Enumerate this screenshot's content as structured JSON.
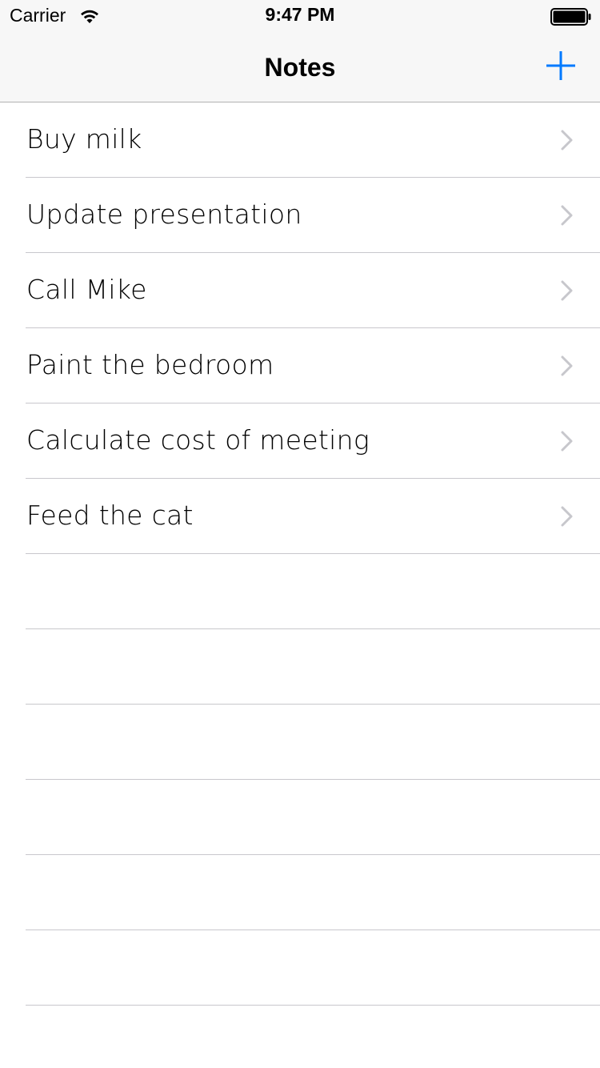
{
  "status_bar": {
    "carrier": "Carrier",
    "time": "9:47 PM",
    "wifi_icon": "wifi-icon",
    "battery_icon": "battery-icon"
  },
  "nav_bar": {
    "title": "Notes",
    "add_icon": "plus-icon",
    "accent_color": "#007aff"
  },
  "notes": {
    "items": [
      {
        "label": "Buy milk"
      },
      {
        "label": "Update presentation"
      },
      {
        "label": "Call Mike"
      },
      {
        "label": "Paint the bedroom"
      },
      {
        "label": "Calculate cost of meeting"
      },
      {
        "label": "Feed the cat"
      }
    ],
    "chevron_icon": "chevron-right-icon",
    "empty_rows": 6
  },
  "colors": {
    "nav_background": "#f7f7f7",
    "separator": "#c8c7cc",
    "chevron": "#c7c7cc",
    "text": "#000000"
  }
}
